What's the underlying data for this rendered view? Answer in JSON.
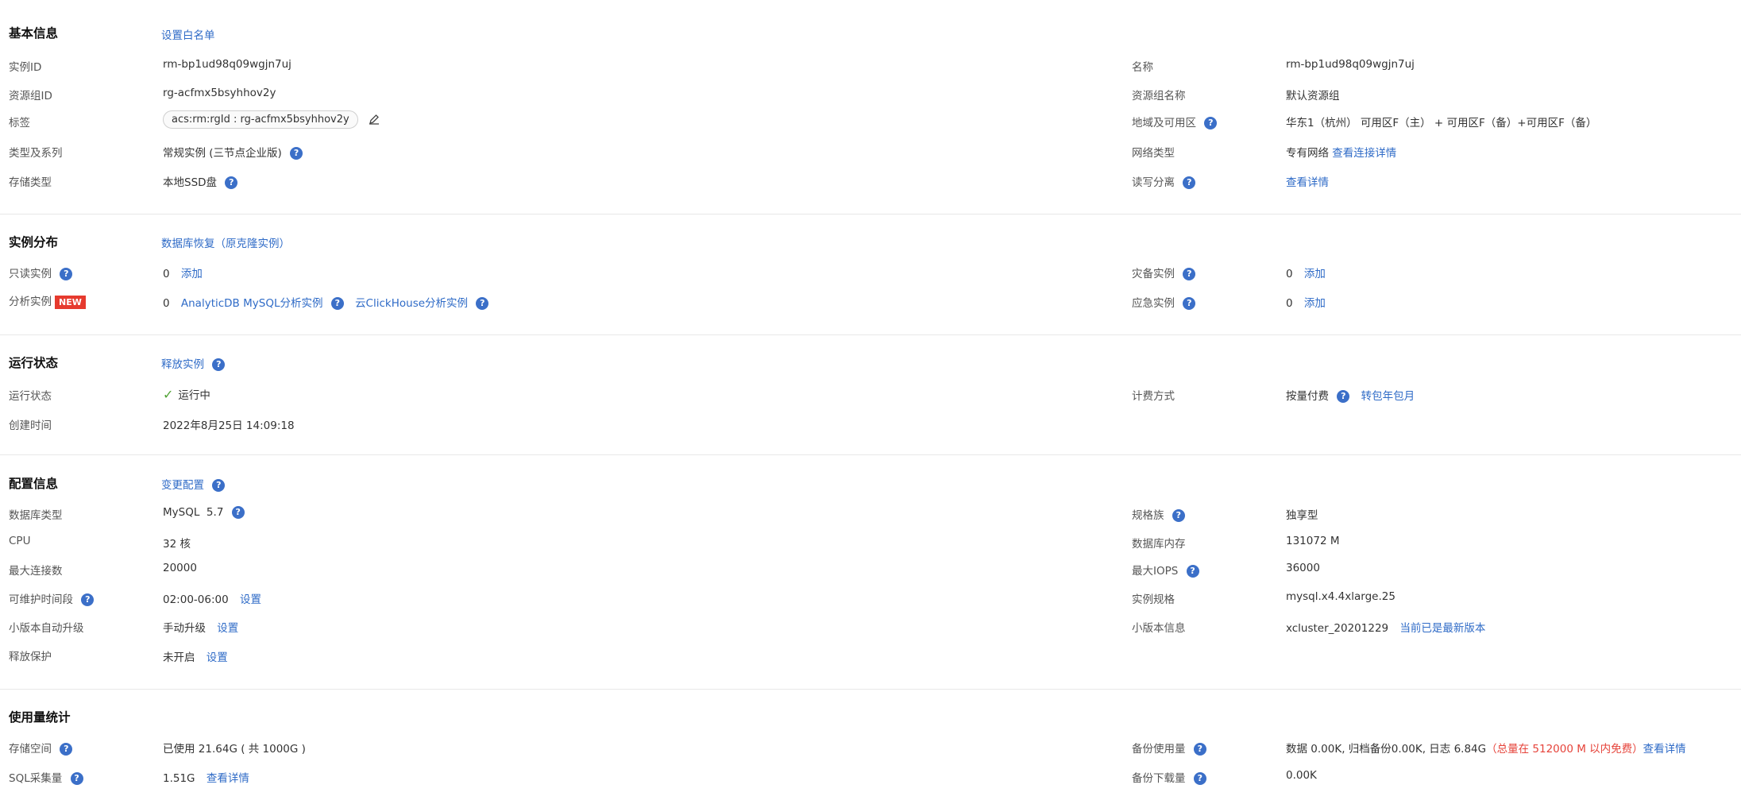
{
  "basic": {
    "title": "基本信息",
    "action": "设置白名单",
    "instance_id_label": "实例ID",
    "instance_id": "rm-bp1ud98q09wgjn7uj",
    "name_label": "名称",
    "name": "rm-bp1ud98q09wgjn7uj",
    "rg_id_label": "资源组ID",
    "rg_id": "rg-acfmx5bsyhhov2y",
    "rg_name_label": "资源组名称",
    "rg_name": "默认资源组",
    "tag_label": "标签",
    "tag_value": "acs:rm:rgId : rg-acfmx5bsyhhov2y",
    "region_label": "地域及可用区",
    "region_value": "华东1（杭州） 可用区F（主） + 可用区F（备）+可用区F（备）",
    "type_label": "类型及系列",
    "type_value": "常规实例 (三节点企业版)",
    "network_label": "网络类型",
    "network_value": "专有网络",
    "network_link": "查看连接详情",
    "storage_label": "存储类型",
    "storage_value": "本地SSD盘",
    "rw_label": "读写分离",
    "rw_link": "查看详情"
  },
  "distribution": {
    "title": "实例分布",
    "action": "数据库恢复（原克隆实例）",
    "readonly_label": "只读实例",
    "readonly_count": "0",
    "readonly_add": "添加",
    "dr_label": "灾备实例",
    "dr_count": "0",
    "dr_add": "添加",
    "analysis_label": "分析实例",
    "analysis_badge": "NEW",
    "analysis_count": "0",
    "analysis_link1": "AnalyticDB MySQL分析实例",
    "analysis_link2": "云ClickHouse分析实例",
    "emergency_label": "应急实例",
    "emergency_count": "0",
    "emergency_add": "添加"
  },
  "status": {
    "title": "运行状态",
    "action": "释放实例",
    "state_label": "运行状态",
    "state_value": "运行中",
    "billing_label": "计费方式",
    "billing_value": "按量付费",
    "billing_link": "转包年包月",
    "created_label": "创建时间",
    "created_value": "2022年8月25日 14:09:18"
  },
  "config": {
    "title": "配置信息",
    "action": "变更配置",
    "dbtype_label": "数据库类型",
    "dbtype_value": "MySQL  5.7",
    "family_label": "规格族",
    "family_value": "独享型",
    "cpu_label": "CPU",
    "cpu_value": "32 核",
    "mem_label": "数据库内存",
    "mem_value": "131072 M",
    "conn_label": "最大连接数",
    "conn_value": "20000",
    "iops_label": "最大IOPS",
    "iops_value": "36000",
    "maint_label": "可维护时间段",
    "maint_value": "02:00-06:00",
    "maint_link": "设置",
    "spec_label": "实例规格",
    "spec_value": "mysql.x4.4xlarge.25",
    "minor_label": "小版本自动升级",
    "minor_value": "手动升级",
    "minor_link": "设置",
    "minorinfo_label": "小版本信息",
    "minorinfo_value": "xcluster_20201229",
    "minorinfo_link": "当前已是最新版本",
    "release_label": "释放保护",
    "release_value": "未开启",
    "release_link": "设置"
  },
  "usage": {
    "title": "使用量统计",
    "storage_label": "存储空间",
    "storage_value": "已使用 21.64G ( 共 1000G )",
    "backup_label": "备份使用量",
    "backup_value": "数据 0.00K, 归档备份0.00K, 日志 6.84G",
    "backup_free": "（总量在 512000 M 以内免费）",
    "backup_link": "查看详情",
    "sql_label": "SQL采集量",
    "sql_value": "1.51G",
    "sql_link": "查看详情",
    "download_label": "备份下载量",
    "download_value": "0.00K"
  },
  "icons": {
    "help": "question-circle-icon",
    "edit": "pencil-icon",
    "check": "check-icon"
  }
}
